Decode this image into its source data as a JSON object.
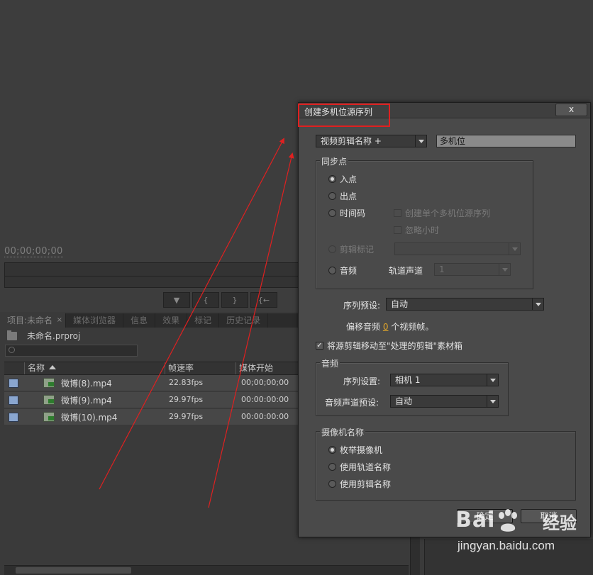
{
  "monitor": {
    "timecode": "00;00;00;00",
    "transport": [
      "▼",
      "{",
      "}",
      "{←"
    ]
  },
  "project_panel": {
    "tabs": [
      {
        "label": "项目:未命名",
        "close": "×"
      },
      {
        "label": "媒体浏览器"
      },
      {
        "label": "信息"
      },
      {
        "label": "效果"
      },
      {
        "label": "标记"
      },
      {
        "label": "历史记录"
      }
    ],
    "project_file": "未命名.prproj",
    "columns": {
      "name": "名称",
      "fps": "帧速率",
      "start": "媒体开始"
    },
    "rows": [
      {
        "name": "微博(8).mp4",
        "fps": "22.83fps",
        "start": "00;00;00;00"
      },
      {
        "name": "微博(9).mp4",
        "fps": "29.97fps",
        "start": "00:00:00:00"
      },
      {
        "name": "微博(10).mp4",
        "fps": "29.97fps",
        "start": "00:00:00:00"
      }
    ]
  },
  "dialog": {
    "title": "创建多机位源序列",
    "close": "x",
    "name_mode": "视频剪辑名称 +",
    "name_value": "多机位",
    "sync": {
      "title": "同步点",
      "in_point": "入点",
      "out_point": "出点",
      "timecode": "时间码",
      "create_single": "创建单个多机位源序列",
      "ignore_hours": "忽略小时",
      "clip_marker": "剪辑标记",
      "audio": "音频",
      "track_channel_label": "轨道声道",
      "track_channel_value": "1"
    },
    "sequence_preset_label": "序列预设:",
    "sequence_preset_value": "自动",
    "offset_prefix": "偏移音频",
    "offset_value": "0",
    "offset_suffix": "个视频帧。",
    "move_clips": "将源剪辑移动至\"处理的剪辑\"素材箱",
    "audio_group": {
      "title": "音频",
      "seq_settings_label": "序列设置:",
      "seq_settings_value": "相机 1",
      "channel_preset_label": "音频声道预设:",
      "channel_preset_value": "自动"
    },
    "camera_names": {
      "title": "摄像机名称",
      "enumerate": "枚举摄像机",
      "use_track": "使用轨道名称",
      "use_clip": "使用剪辑名称"
    },
    "ok": "确定",
    "cancel": "取消"
  },
  "watermark": {
    "logo": "Bai",
    "logo_tail": "经验",
    "url": "jingyan.baidu.com"
  },
  "colors": {
    "annotation": "#e02020",
    "label_chip": "#8aa6cf",
    "link": "#e0a52a"
  }
}
